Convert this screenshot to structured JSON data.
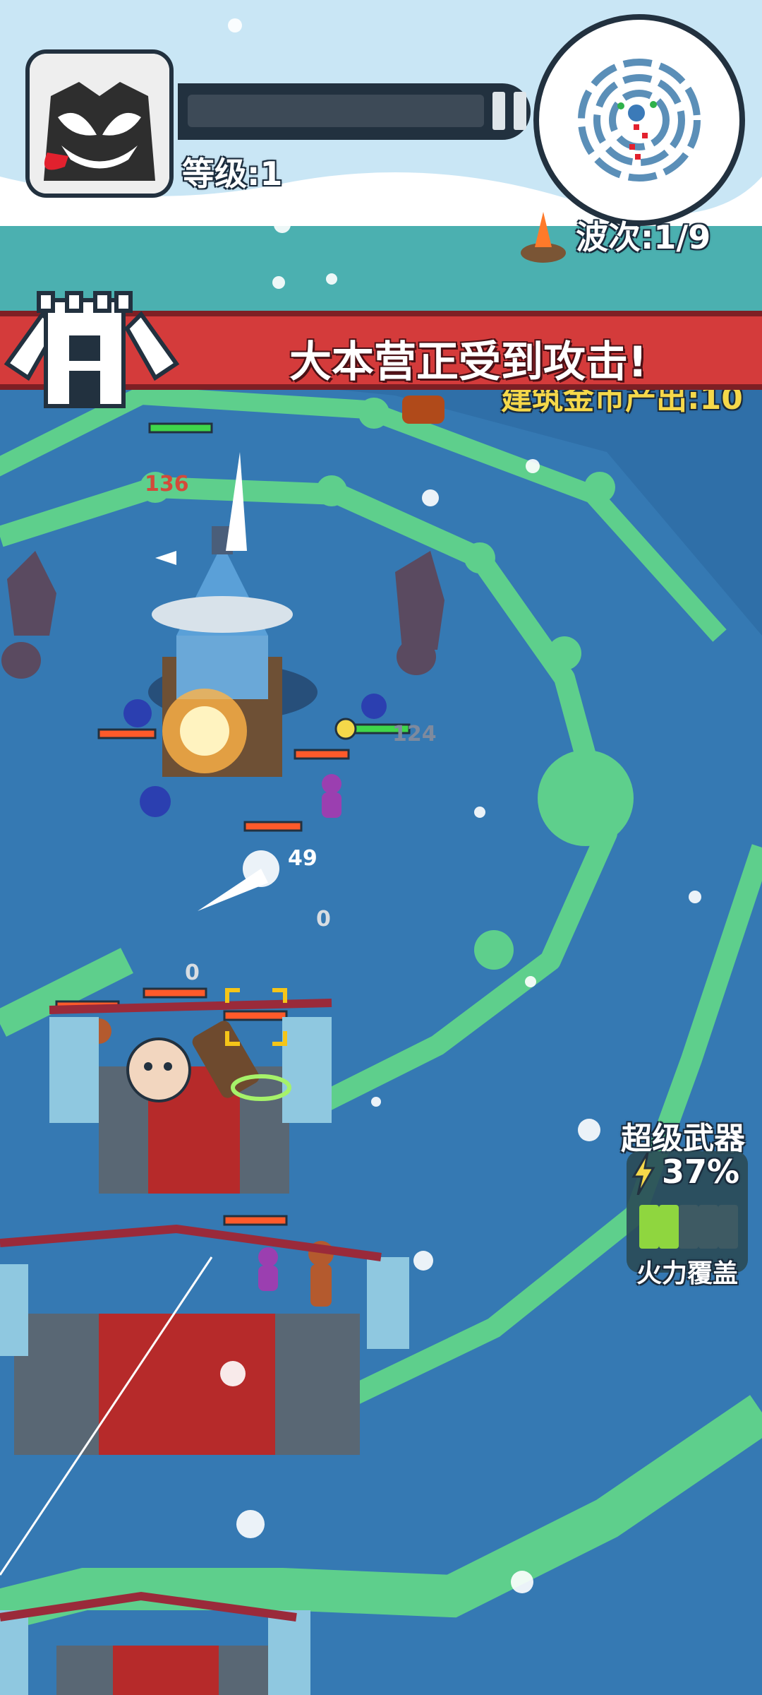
{
  "hud": {
    "level_label": "等级:1",
    "wave_label": "波次:1/9"
  },
  "alert": {
    "message": "大本营正受到攻击!",
    "partial_text": "建筑金币产出:10"
  },
  "super_weapon": {
    "title": "超级武器",
    "charge_percent": "37%",
    "charge_fraction": 0.37,
    "mode_label": "火力覆盖",
    "segments_total": 5,
    "segments_filled": 2
  },
  "combat_numbers": {
    "tower_hp": "136",
    "damage_a": "124",
    "damage_b": "49",
    "damage_c": "0",
    "damage_d": "0"
  },
  "icons": {
    "avatar": "venom-face-icon",
    "pause": "pause-icon",
    "castle": "castle-icon",
    "bolt": "lightning-bolt-icon"
  },
  "colors": {
    "ground": "#2f6fa8",
    "wall": "#5ecf8c",
    "alert_red": "#d43b3b",
    "health_green": "#3fd64a",
    "enemy_health": "#ff5a2a",
    "hud_dark": "#22313f"
  }
}
